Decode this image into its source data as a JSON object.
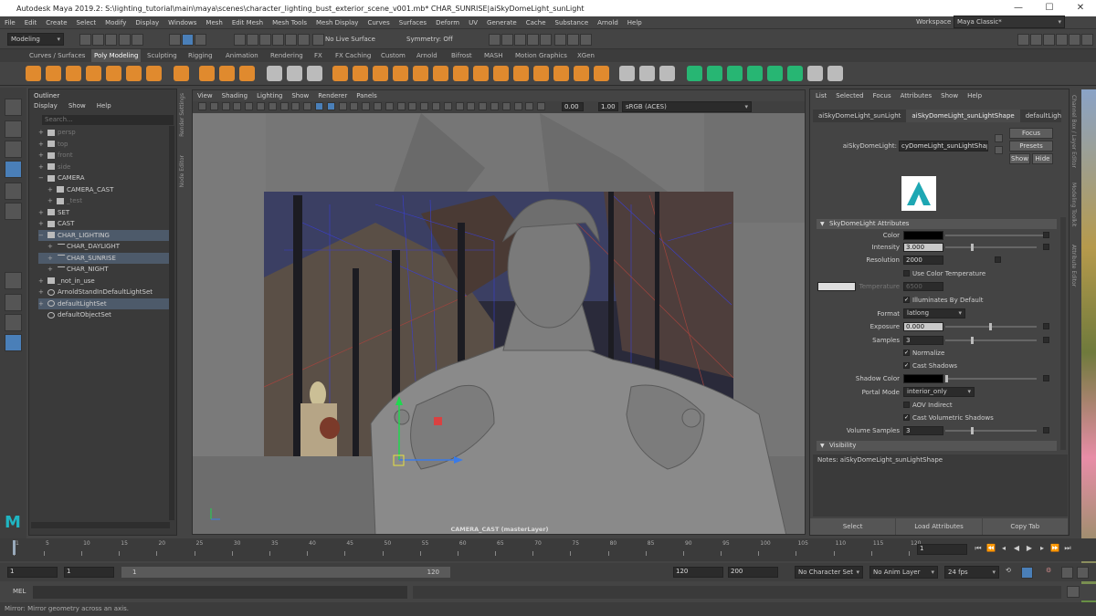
{
  "title": "Autodesk Maya 2019.2: S:\\lighting_tutorial\\main\\maya\\scenes\\character_lighting_bust_exterior_scene_v001.mb*    CHAR_SUNRISE|aiSkyDomeLight_sunLight",
  "window_controls": [
    "—",
    "☐",
    "✕"
  ],
  "menu": [
    "File",
    "Edit",
    "Create",
    "Select",
    "Modify",
    "Display",
    "Windows",
    "Mesh",
    "Edit Mesh",
    "Mesh Tools",
    "Mesh Display",
    "Curves",
    "Surfaces",
    "Deform",
    "UV",
    "Generate",
    "Cache",
    "Substance",
    "Arnold",
    "Help"
  ],
  "workspace": {
    "label": "Workspace :",
    "value": "Maya Classic*"
  },
  "status": {
    "mode": "Modeling",
    "live_surface": "No Live Surface",
    "symmetry": "Symmetry: Off"
  },
  "shelf_tabs": [
    "Curves / Surfaces",
    "Poly Modeling",
    "Sculpting",
    "Rigging",
    "Animation",
    "Rendering",
    "FX",
    "FX Caching",
    "Custom",
    "Arnold",
    "Bifrost",
    "MASH",
    "Motion Graphics",
    "XGen"
  ],
  "shelf_active": "Poly Modeling",
  "outliner": {
    "title": "Outliner",
    "menu": [
      "Display",
      "Show",
      "Help"
    ],
    "search": "Search...",
    "rows": [
      {
        "label": "persp",
        "indent": 0,
        "icon": "camera",
        "dim": true,
        "exp": "+"
      },
      {
        "label": "top",
        "indent": 0,
        "icon": "camera",
        "dim": true,
        "exp": "+"
      },
      {
        "label": "front",
        "indent": 0,
        "icon": "camera",
        "dim": true,
        "exp": "+"
      },
      {
        "label": "side",
        "indent": 0,
        "icon": "camera",
        "dim": true,
        "exp": "+"
      },
      {
        "label": "CAMERA",
        "indent": 0,
        "icon": "group",
        "dim": false,
        "exp": "−"
      },
      {
        "label": "CAMERA_CAST",
        "indent": 1,
        "icon": "camera",
        "dim": false,
        "exp": "+"
      },
      {
        "label": "_test",
        "indent": 1,
        "icon": "group",
        "dim": true,
        "exp": "+"
      },
      {
        "label": "SET",
        "indent": 0,
        "icon": "group",
        "dim": false,
        "exp": "+"
      },
      {
        "label": "CAST",
        "indent": 0,
        "icon": "group",
        "dim": false,
        "exp": "+"
      },
      {
        "label": "CHAR_LIGHTING",
        "indent": 0,
        "icon": "group",
        "dim": false,
        "exp": "−",
        "sel": true
      },
      {
        "label": "CHAR_DAYLIGHT",
        "indent": 1,
        "icon": "light",
        "dim": false,
        "exp": "+"
      },
      {
        "label": "CHAR_SUNRISE",
        "indent": 1,
        "icon": "light",
        "dim": false,
        "exp": "+",
        "sel": true
      },
      {
        "label": "CHAR_NIGHT",
        "indent": 1,
        "icon": "light",
        "dim": false,
        "exp": "+"
      },
      {
        "label": "_not_in_use",
        "indent": 0,
        "icon": "group",
        "dim": false,
        "exp": "+"
      },
      {
        "label": "ArnoldStandInDefaultLightSet",
        "indent": 0,
        "icon": "set",
        "dim": false,
        "exp": "+"
      },
      {
        "label": "defaultLightSet",
        "indent": 0,
        "icon": "set",
        "dim": false,
        "exp": "+",
        "sel": true
      },
      {
        "label": "defaultObjectSet",
        "indent": 0,
        "icon": "set",
        "dim": false,
        "exp": ""
      }
    ]
  },
  "side_labels": [
    "Render Settings",
    "Node Editor"
  ],
  "viewport": {
    "menu": [
      "View",
      "Shading",
      "Lighting",
      "Show",
      "Renderer",
      "Panels"
    ],
    "exposure": "0.00",
    "gamma": "1.00",
    "colorspace": "sRGB (ACES)",
    "camera_label": "CAMERA_CAST (masterLayer)"
  },
  "attr": {
    "menu": [
      "List",
      "Selected",
      "Focus",
      "Attributes",
      "Show",
      "Help"
    ],
    "tabs": [
      "aiSkyDomeLight_sunLight",
      "aiSkyDomeLight_sunLightShape",
      "defaultLigh"
    ],
    "active_tab": "aiSkyDomeLight_sunLightShape",
    "node_label": "aiSkyDomeLight:",
    "node_value": "cyDomeLight_sunLightShape",
    "buttons": [
      "Focus",
      "Presets",
      "Show",
      "Hide"
    ],
    "section": "SkyDomeLight Attributes",
    "fields": {
      "color": "Color",
      "intensity_l": "Intensity",
      "intensity": "3.000",
      "resolution_l": "Resolution",
      "resolution": "2000",
      "use_color_temp": "Use Color Temperature",
      "temperature_l": "Temperature",
      "temperature": "6500",
      "illum": "Illuminates By Default",
      "format_l": "Format",
      "format": "latlong",
      "exposure_l": "Exposure",
      "exposure": "0.000",
      "samples_l": "Samples",
      "samples": "3",
      "normalize": "Normalize",
      "cast_shadows": "Cast Shadows",
      "shadow_color": "Shadow Color",
      "portal_l": "Portal Mode",
      "portal": "interior_only",
      "aov": "AOV Indirect",
      "cast_vol": "Cast Volumetric Shadows",
      "vol_samples_l": "Volume Samples",
      "vol_samples": "3"
    },
    "section2": "Visibility",
    "notes": "Notes:  aiSkyDomeLight_sunLightShape",
    "footer": [
      "Select",
      "Load Attributes",
      "Copy Tab"
    ]
  },
  "right_strip": [
    "Channel Box / Layer Editor",
    "Modeling Toolkit",
    "Attribute Editor"
  ],
  "timeline": {
    "ticks": [
      "1",
      "5",
      "10",
      "15",
      "20",
      "25",
      "30",
      "35",
      "40",
      "45",
      "50",
      "55",
      "60",
      "65",
      "70",
      "75",
      "80",
      "85",
      "90",
      "95",
      "100",
      "105",
      "110",
      "115",
      "120"
    ],
    "current": "1"
  },
  "range": {
    "start": "1",
    "start2": "1",
    "slider_start": "1",
    "slider_end": "120",
    "end": "120",
    "end2": "200",
    "char_set": "No Character Set",
    "anim_layer": "No Anim Layer",
    "fps": "24 fps"
  },
  "cmd": {
    "lang": "MEL"
  },
  "help": "Mirror: Mirror geometry across an axis."
}
